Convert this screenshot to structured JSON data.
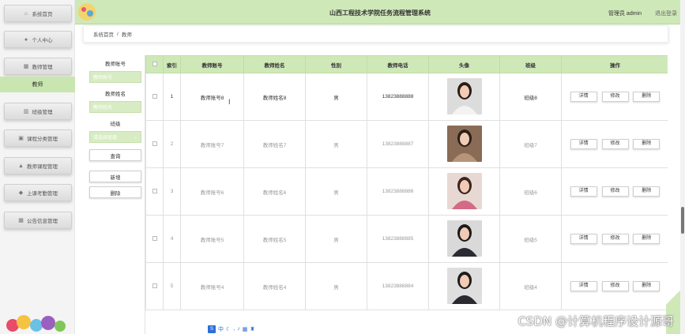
{
  "header": {
    "title": "山西工程技术学院任务流程管理系统",
    "user": "管理员 admin",
    "logout": "退出登录"
  },
  "sidebar": {
    "items": [
      {
        "label": "系统首页",
        "icon": "home-icon"
      },
      {
        "label": "个人中心",
        "icon": "user-icon"
      },
      {
        "label": "教师管理",
        "icon": "grid-icon"
      },
      {
        "label": "班级管理",
        "icon": "bank-icon"
      },
      {
        "label": "课程分类管理",
        "icon": "folder-icon"
      },
      {
        "label": "教师课程管理",
        "icon": "person-icon"
      },
      {
        "label": "上课考勤管理",
        "icon": "shield-icon"
      },
      {
        "label": "公告信息管理",
        "icon": "grid-icon"
      }
    ],
    "active_sub": "教师"
  },
  "breadcrumb": {
    "home": "系统首页",
    "sep": "/",
    "current": "教师"
  },
  "search": {
    "label_account": "教师账号",
    "placeholder_account": "教师账号",
    "label_name": "教师姓名",
    "placeholder_name": "教师姓名",
    "label_class": "班级",
    "placeholder_class": "请选择班级",
    "query": "查询",
    "add": "新增",
    "delete": "删除"
  },
  "table": {
    "headers": [
      "",
      "索引",
      "教师账号",
      "教师姓名",
      "性别",
      "教师电话",
      "头像",
      "班级",
      "操作"
    ],
    "actions": {
      "detail": "详情",
      "edit": "修改",
      "remove": "删除"
    },
    "rows": [
      {
        "index": "1",
        "account": "教师账号8",
        "name": "教师姓名8",
        "gender": "男",
        "phone": "13823888888",
        "class": "班级8",
        "avatar": "female-white"
      },
      {
        "index": "2",
        "account": "教师账号7",
        "name": "教师姓名7",
        "gender": "男",
        "phone": "13823888887",
        "class": "班级7",
        "avatar": "male-suit"
      },
      {
        "index": "3",
        "account": "教师账号6",
        "name": "教师姓名6",
        "gender": "男",
        "phone": "13823888886",
        "class": "班级6",
        "avatar": "female-smile"
      },
      {
        "index": "4",
        "account": "教师账号5",
        "name": "教师姓名5",
        "gender": "男",
        "phone": "13823888885",
        "class": "班级5",
        "avatar": "female-dark"
      },
      {
        "index": "5",
        "account": "教师账号4",
        "name": "教师姓名4",
        "gender": "男",
        "phone": "13823888884",
        "class": "班级4",
        "avatar": "female-dark2"
      }
    ]
  },
  "overlay": {
    "watermark": "CSDN @计算机程序设计源哥",
    "ime": "中"
  }
}
